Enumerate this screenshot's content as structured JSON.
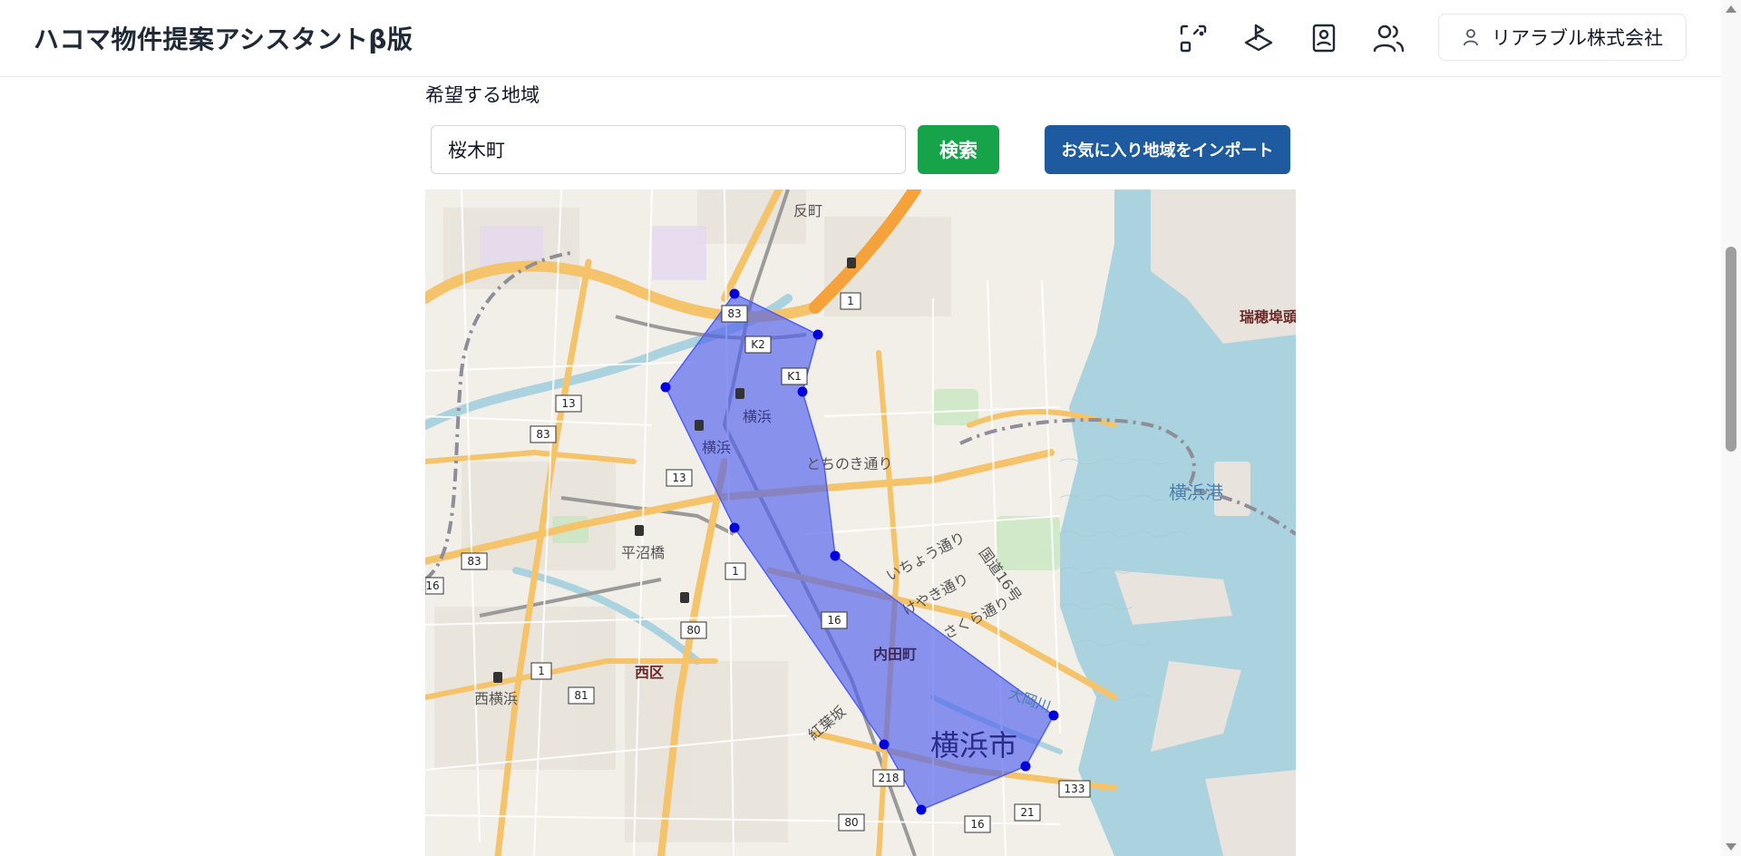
{
  "header": {
    "title": "ハコマ物件提案アシスタントβ版",
    "icons": [
      "scan-icon",
      "pin-layers-icon",
      "contact-book-icon",
      "users-icon"
    ],
    "company_name": "リアラブル株式会社"
  },
  "region": {
    "label": "希望する地域",
    "search_value": "桜木町",
    "search_button": "検索",
    "import_button": "お気に入り地域をインポート"
  },
  "map": {
    "area_labels": {
      "sorimachi": "反町",
      "yokohama_station_1": "横浜",
      "yokohama_station_2": "横浜",
      "tochinoki": "とちのき通り",
      "hiranumabashi": "平沼橋",
      "nishi_ku": "西区",
      "nishi_yokohama": "西横浜",
      "uchidacho": "内田町",
      "yokohama_shi": "横浜市",
      "yokohama_port": "横浜港",
      "mizuho_pier": "瑞穂埠頭",
      "icho": "いちょう通り",
      "keyaki": "けやき通り",
      "sakura": "さくら通り",
      "kohan": "紅葉坂",
      "ooka_river": "大岡川",
      "bay_road": "国道16号"
    },
    "route_shields": [
      "83",
      "K2",
      "K1",
      "1",
      "13",
      "83",
      "13",
      "83",
      "16",
      "1",
      "80",
      "1",
      "81",
      "16",
      "218",
      "133",
      "21",
      "80",
      "16"
    ],
    "polygon_color": "#4f5ff0",
    "vertex_color": "#0000e0",
    "vertex_count": 10
  }
}
